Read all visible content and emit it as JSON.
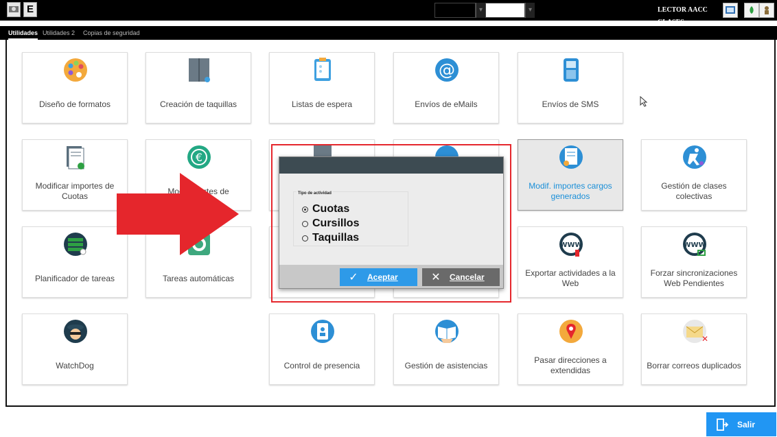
{
  "topbar": {
    "btn1_label": "",
    "btn2_label": "E",
    "reader_label": "LECTOR AACC CLASES"
  },
  "tabs": [
    {
      "label": "Utilidades",
      "active": true
    },
    {
      "label": "Utilidades 2",
      "active": false
    },
    {
      "label": "Copias de seguridad",
      "active": false
    }
  ],
  "tiles": {
    "diseno": {
      "label": "Diseño de formatos",
      "icon": "palette-icon"
    },
    "taquillas": {
      "label": "Creación de taquillas",
      "icon": "locker-icon"
    },
    "listas": {
      "label": "Listas de espera",
      "icon": "clipboard-icon"
    },
    "emails": {
      "label": "Envíos de eMails",
      "icon": "at-icon"
    },
    "sms": {
      "label": "Envíos de SMS",
      "icon": "phone-icon"
    },
    "mod_cuotas": {
      "label": "Modificar importes de Cuotas",
      "icon": "document-icon"
    },
    "mod_otros": {
      "label": "Modi      mportes de",
      "icon": "euro-icon"
    },
    "mod_cargos": {
      "label": "Modif. importes cargos generados",
      "icon": "invoice-icon"
    },
    "clases": {
      "label": "Gestión de clases colectivas",
      "icon": "martial-arts-icon"
    },
    "planificador": {
      "label": "Planificador de tareas",
      "icon": "server-icon"
    },
    "automaticas": {
      "label": "Tareas automáticas",
      "icon": "gear-icon"
    },
    "exportar": {
      "label": "Exportar actividades a la Web",
      "icon": "www-icon"
    },
    "forzar": {
      "label": "Forzar sincronizaciones Web Pendientes",
      "icon": "www-sync-icon"
    },
    "watchdog": {
      "label": "WatchDog",
      "icon": "spy-icon"
    },
    "presencia": {
      "label": "Control de presencia",
      "icon": "badge-icon"
    },
    "asistencias": {
      "label": "Gestión de asistencias",
      "icon": "book-icon"
    },
    "direcciones": {
      "label": "Pasar direcciones a extendidas",
      "icon": "map-pin-icon"
    },
    "correos": {
      "label": "Borrar correos duplicados",
      "icon": "mail-delete-icon"
    }
  },
  "dialog": {
    "group_title": "Tipo de actividad",
    "options": [
      {
        "label": "Cuotas",
        "selected": true
      },
      {
        "label": "Cursillos",
        "selected": false
      },
      {
        "label": "Taquillas",
        "selected": false
      }
    ],
    "ok_label": "Aceptar",
    "cancel_label": "Cancelar"
  },
  "salir_label": "Salir",
  "colors": {
    "accent": "#2196f3",
    "dialog_header": "#3d4b52",
    "highlight": "#e5262c"
  }
}
